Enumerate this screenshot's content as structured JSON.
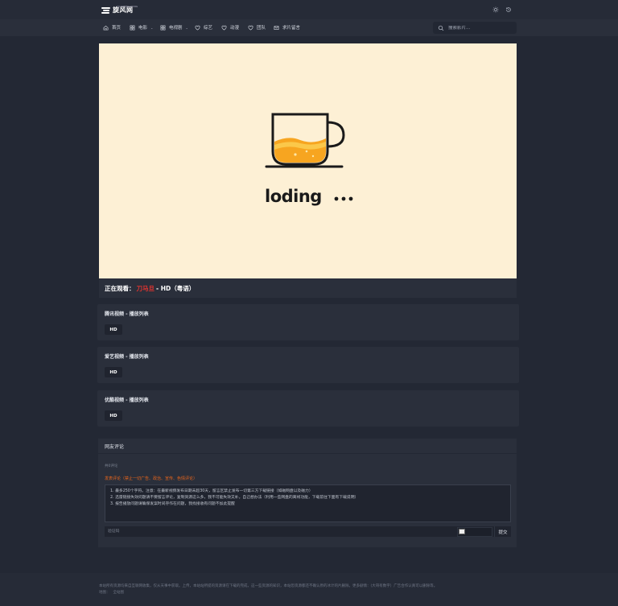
{
  "brand": {
    "name": "旋风网",
    "sub": "XUANFENGWANG"
  },
  "nav": {
    "items": [
      {
        "label": "首页",
        "icon": "home-icon",
        "dropdown": false
      },
      {
        "label": "电影",
        "icon": "grid-icon",
        "dropdown": true
      },
      {
        "label": "电视剧",
        "icon": "grid-icon",
        "dropdown": true
      },
      {
        "label": "综艺",
        "icon": "heart-icon",
        "dropdown": false
      },
      {
        "label": "动漫",
        "icon": "heart-icon",
        "dropdown": false
      },
      {
        "label": "团队",
        "icon": "heart-icon",
        "dropdown": false
      },
      {
        "label": "求片留言",
        "icon": "mail-icon",
        "dropdown": false
      }
    ]
  },
  "search": {
    "placeholder": "搜索影片..."
  },
  "player": {
    "loading_text": "loding"
  },
  "now_playing": {
    "prefix": "正在观看：",
    "title": "刀马旦",
    "suffix": "- HD（粤语）"
  },
  "playlists": [
    {
      "title": "腾讯视频 - 播放列表",
      "episodes": [
        "HD"
      ]
    },
    {
      "title": "爱艺视频 - 播放列表",
      "episodes": [
        "HD"
      ]
    },
    {
      "title": "优酷视频 - 播放列表",
      "episodes": [
        "HD"
      ]
    }
  ],
  "comments": {
    "title": "网友评论",
    "count_label": "共0评论",
    "rule": "发表评论（禁止一切广告、政治、宣传、色情评论）",
    "placeholder_lines": [
      "1. 最多250个字符。注意：在最新视频发布日期未超30天，留言区禁止发布一切第三方下载链接（如磁网盘以及磁力）",
      "2. 迅雷链接失效问题请不要留言评论，复制资源这么多，我不可能失效又补。自己想办法（利用一些网盘的离线功能，下载前往下面有下载说明）",
      "3. 报告播放问题请确保发案时间存作在问题，我找接收有问题不加此提醒"
    ],
    "captcha_placeholder": "验证码",
    "submit_label": "提交"
  },
  "footer": {
    "text": "本站所有资源均来自互联网收集，仅从天事中获取。上传，本站站所提的资源请在下载的完成，这一些资源的知识，本站恐资源都还不确认原的冰计的片删除。更多剧情：(大哥有数字）广告合作认真可以删除等。",
    "links": [
      "地图：",
      "全站图"
    ]
  }
}
